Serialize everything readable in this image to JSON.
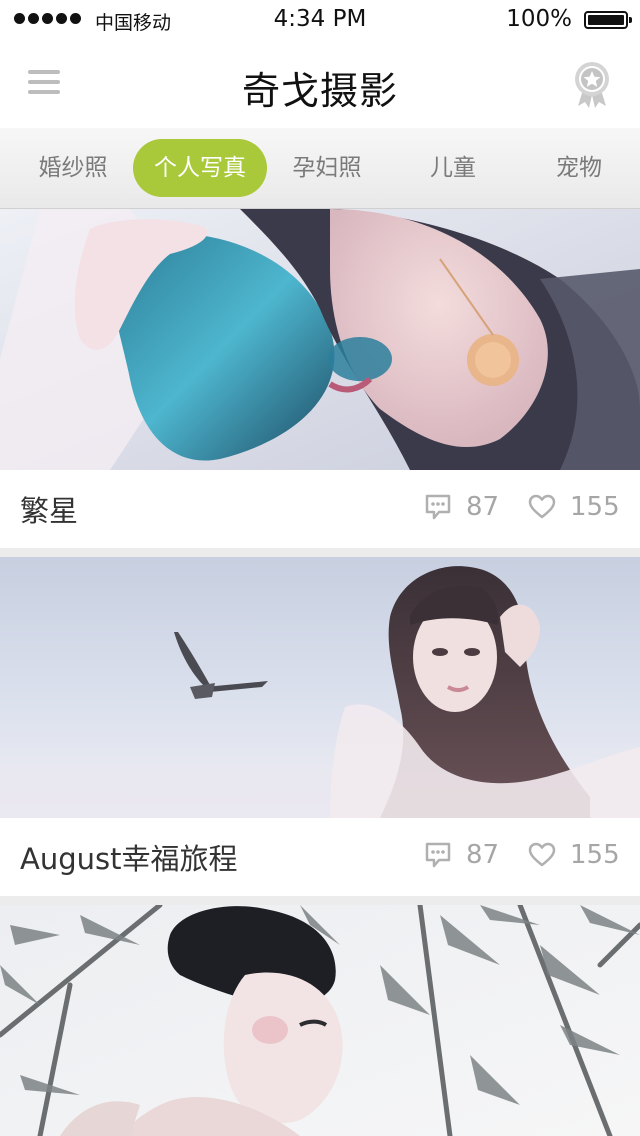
{
  "status": {
    "carrier": "中国移动",
    "time": "4:34 PM",
    "battery": "100%"
  },
  "nav": {
    "title": "奇戈摄影",
    "menu_icon": "hamburger-menu-icon",
    "right_icon": "award-badge-icon"
  },
  "tabs": [
    {
      "label": "婚纱照"
    },
    {
      "label": "个人写真"
    },
    {
      "label": "孕妇照"
    },
    {
      "label": "儿童"
    },
    {
      "label": "宠物"
    }
  ],
  "active_tab": "个人写真",
  "colors": {
    "accent": "#a9c83a",
    "icon_gray": "#bdbdbd",
    "stat_gray": "#a6a6a6"
  },
  "feed": [
    {
      "title": "繁星",
      "comments": "87",
      "likes": "155"
    },
    {
      "title": "August幸福旅程",
      "comments": "87",
      "likes": "155"
    },
    {
      "title": "",
      "comments": "",
      "likes": ""
    }
  ]
}
